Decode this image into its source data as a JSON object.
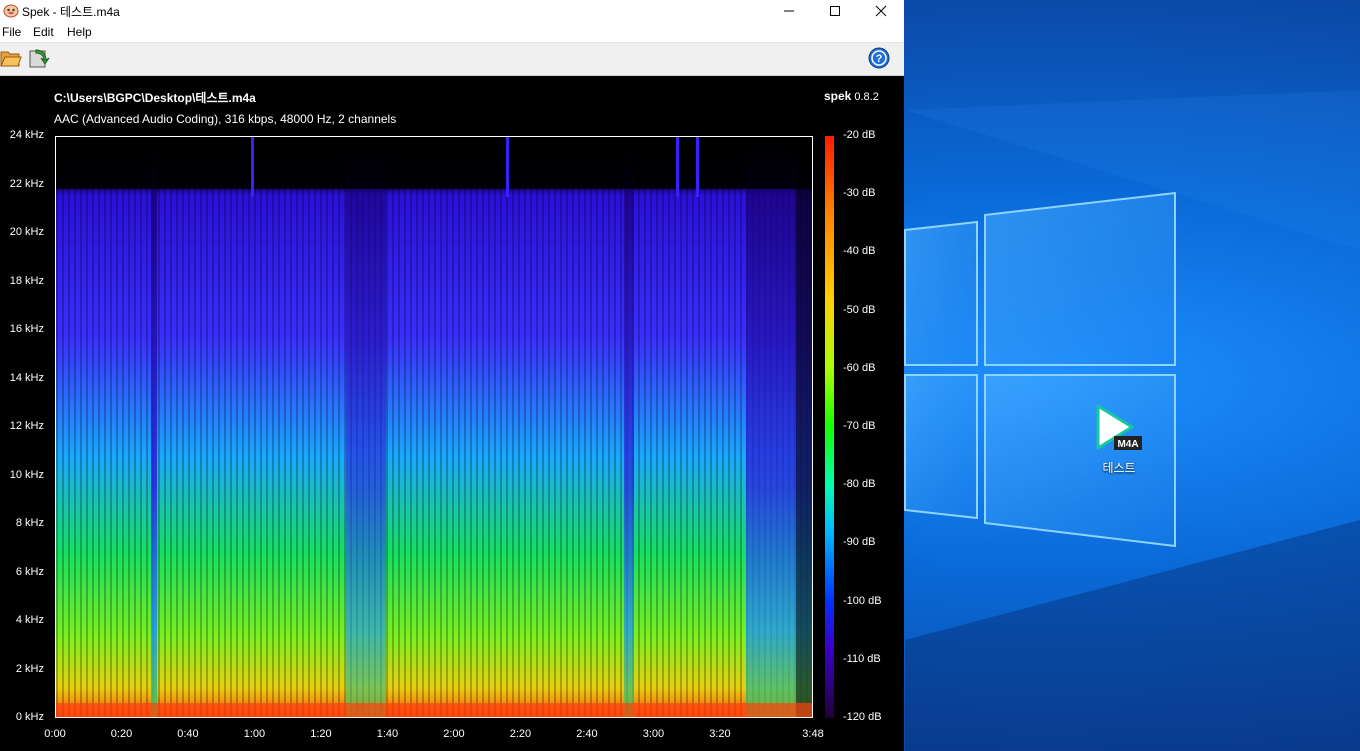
{
  "window": {
    "title": "Spek - 테스트.m4a",
    "menu": [
      "File",
      "Edit",
      "Help"
    ]
  },
  "toolbar": {
    "open_icon": "folder-open-icon",
    "save_icon": "save-export-icon",
    "help_icon": "help-circle-icon"
  },
  "spectrogram": {
    "file_path": "C:\\Users\\BGPC\\Desktop\\테스트.m4a",
    "file_info": "AAC (Advanced Audio Coding), 316 kbps, 48000 Hz, 2 channels",
    "brand_name": "spek",
    "brand_version": "0.8.2",
    "y_ticks": [
      "24 kHz",
      "22 kHz",
      "20 kHz",
      "18 kHz",
      "16 kHz",
      "14 kHz",
      "12 kHz",
      "10 kHz",
      "8 kHz",
      "6 kHz",
      "4 kHz",
      "2 kHz",
      "0 kHz"
    ],
    "x_ticks": [
      "0:00",
      "0:20",
      "0:40",
      "1:00",
      "1:20",
      "1:40",
      "2:00",
      "2:20",
      "2:40",
      "3:00",
      "3:20",
      "3:48"
    ],
    "x_tick_seconds": [
      0,
      20,
      40,
      60,
      80,
      100,
      120,
      140,
      160,
      180,
      200,
      228
    ],
    "duration_seconds": 228,
    "db_ticks": [
      "-20 dB",
      "-30 dB",
      "-40 dB",
      "-50 dB",
      "-60 dB",
      "-70 dB",
      "-80 dB",
      "-90 dB",
      "-100 dB",
      "-110 dB",
      "-120 dB"
    ],
    "colors": {
      "high": "#ff1a00",
      "mid": "#14ff00",
      "low": "#3a00c8"
    }
  },
  "desktop": {
    "icon_label": "테스트",
    "icon_badge": "M4A"
  }
}
